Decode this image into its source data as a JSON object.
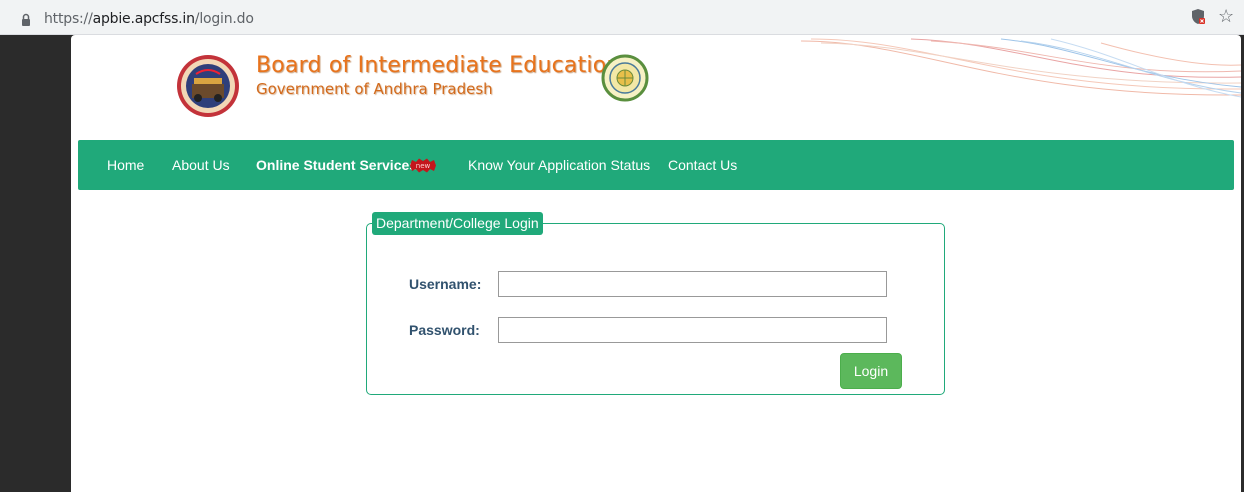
{
  "browser": {
    "url_prefix": "https://",
    "url_host": "apbie.apcfss.in",
    "url_path": "/login.do",
    "icons": [
      "lock-icon",
      "shield-icon",
      "star-icon"
    ]
  },
  "header": {
    "title": "Board of Intermediate Education",
    "subtitle": "Government of Andhra Pradesh",
    "new_badge": "new"
  },
  "nav": {
    "items": [
      "Home",
      "About Us",
      "Online Student Services",
      "Know Your Application Status",
      "Contact Us"
    ]
  },
  "login": {
    "legend": "Department/College Login",
    "username_label": "Username:",
    "username_value": "",
    "password_label": "Password:",
    "password_value": "",
    "login_button": "Login"
  },
  "colors": {
    "accent": "#20a97a",
    "title_orange": "#e8731c",
    "label_blue": "#31526e",
    "button_green": "#5cb85c"
  }
}
